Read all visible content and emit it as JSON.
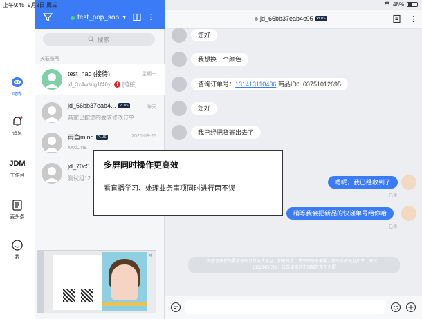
{
  "status_bar": {
    "time": "上午9:45",
    "date": "9月2日 周三",
    "battery": "48%"
  },
  "rail": {
    "items": [
      {
        "label": "咚咚",
        "icon": "chat-bubble-icon",
        "active": true
      },
      {
        "label": "消息",
        "icon": "bell-icon"
      },
      {
        "label": "工作台",
        "icon": "jdm-logo-icon",
        "logo_text": "JDM"
      },
      {
        "label": "麦头条",
        "icon": "news-icon"
      },
      {
        "label": "我",
        "icon": "smile-icon"
      }
    ]
  },
  "list_panel": {
    "shop_name": "test_pop_sop",
    "search_placeholder": "搜索",
    "section_label": "关联账号",
    "conversations": [
      {
        "name": "test_hao (接待)",
        "time": "星期一",
        "preview": "jd_3x4wsug1f46y:",
        "preview_suffix": "[链接]",
        "warning": "!",
        "selected": true
      },
      {
        "name": "jd_66bb37eab4...",
        "plus": "PLUS",
        "time": "昨天",
        "preview": "商家已按您的要求修改订单..."
      },
      {
        "name": "雨鱼mind",
        "plus": "PLUS",
        "time": "2020-08-25",
        "preview": "xxxLma"
      },
      {
        "name": "jd_70c5",
        "preview": "测试组12"
      }
    ]
  },
  "chat": {
    "title": "jd_66bb37eab4c95",
    "plus": "PLUS",
    "messages_in": [
      {
        "text": "您好"
      },
      {
        "text": "我想换一个颜色"
      },
      {
        "prefix": "咨询订单号：",
        "link": "131413110436",
        "suffix": " 商品ID：60751012695"
      },
      {
        "text": "您好"
      },
      {
        "text": "我已经把货寄出去了"
      }
    ],
    "messages_out": [
      {
        "text": "嗯呢，我已经收到了",
        "read": "已读"
      },
      {
        "text": "稍等我会把新品的快递单号给你哈",
        "read": "已读"
      }
    ],
    "system_note": "商家已按您的要求修改订单收货地址，如有异常，请立即联系客服，修改后的地址如下：测试，18623456789，江苏省宿迁市宿城区京东大厦"
  },
  "tooltip": {
    "title": "多屏同时操作更高效",
    "body": "看直播学习、处理业务事项同时进行两不误"
  },
  "colors": {
    "accent": "#3b7cf6",
    "warning": "#e6262e"
  }
}
